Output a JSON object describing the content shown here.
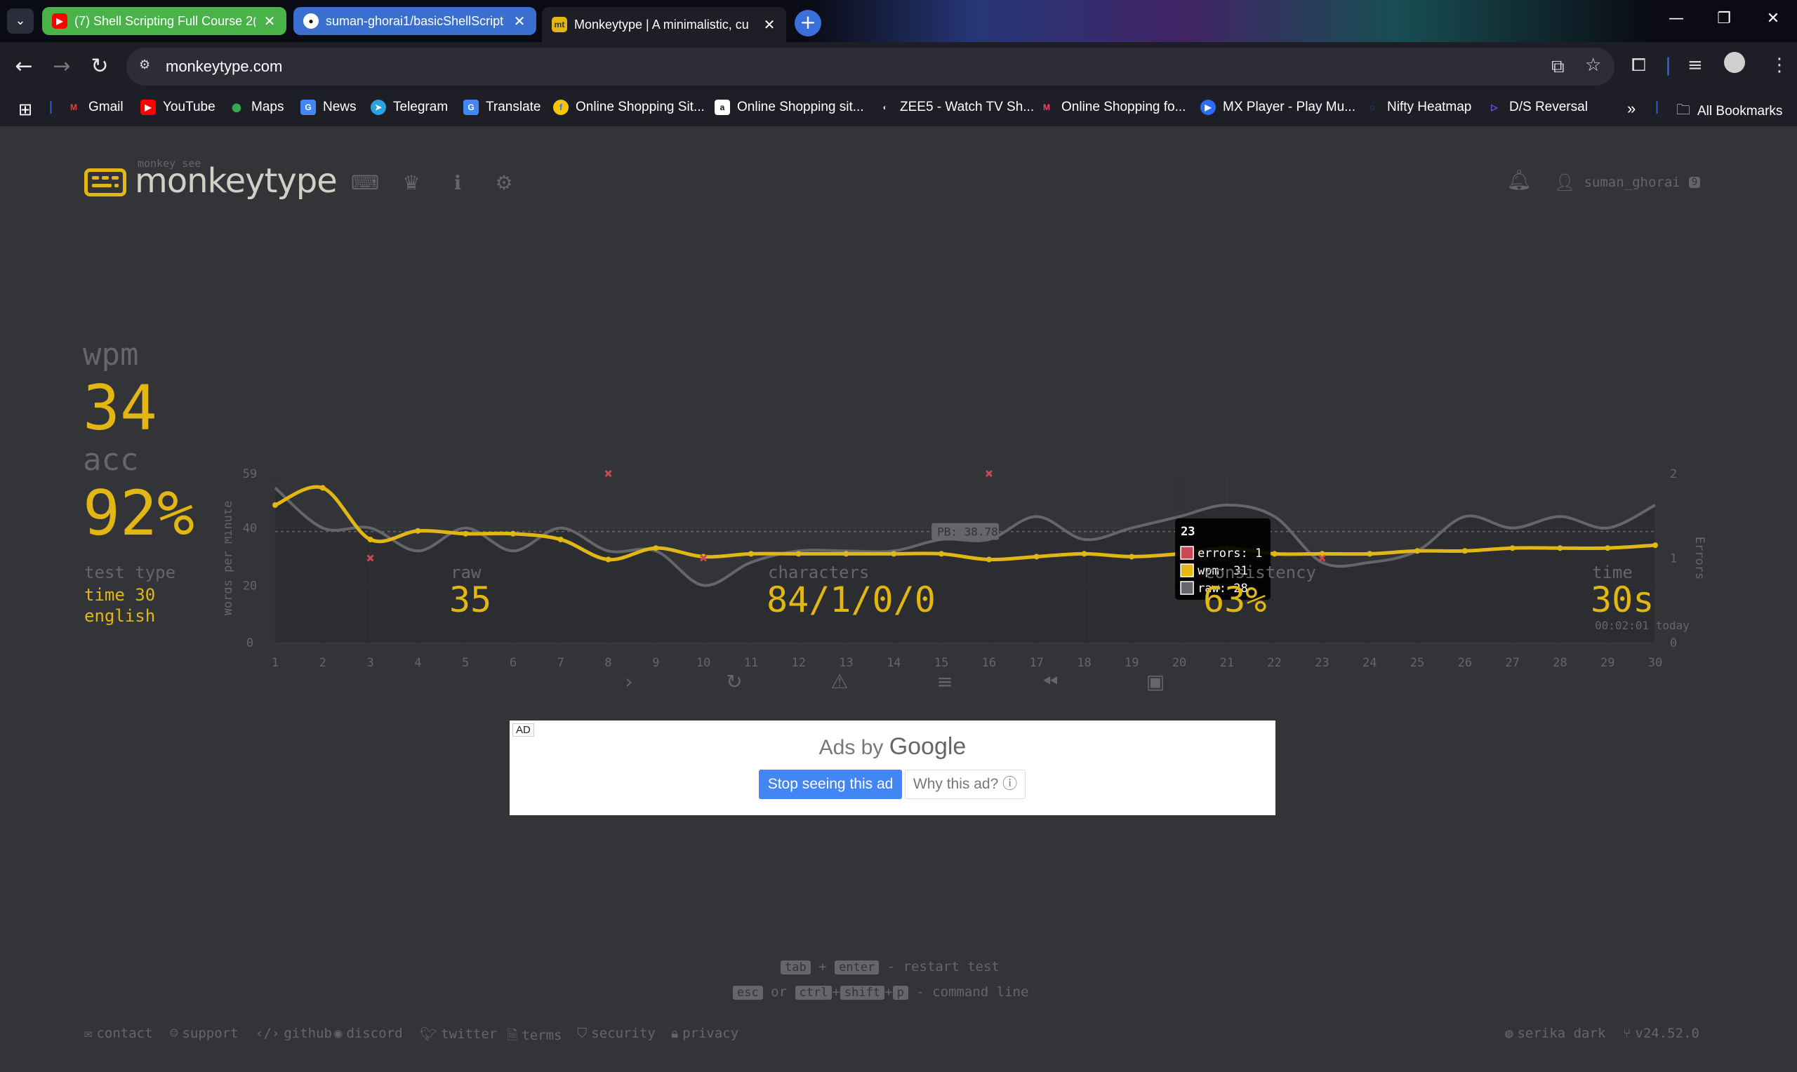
{
  "browser": {
    "tabs": [
      {
        "title": "(7) Shell Scripting Full Course 2(",
        "icon": "youtube-icon"
      },
      {
        "title": "suman-ghorai1/basicShellScript",
        "icon": "github-icon"
      },
      {
        "title": "Monkeytype | A minimalistic, cu",
        "icon": "monkeytype-icon"
      }
    ],
    "url": "monkeytype.com",
    "bookmarks": [
      "Gmail",
      "YouTube",
      "Maps",
      "News",
      "Telegram",
      "Translate",
      "Online Shopping Sit...",
      "Online Shopping sit...",
      "ZEE5 - Watch TV Sh...",
      "Online Shopping fo...",
      "MX Player - Play Mu...",
      "Nifty Heatmap",
      "D/S Reversal"
    ],
    "all_bookmarks": "All Bookmarks"
  },
  "header": {
    "logo_small": "monkey see",
    "logo_text": "monkeytype",
    "username": "suman_ghorai",
    "level": "9"
  },
  "result": {
    "wpm_label": "wpm",
    "wpm": "34",
    "acc_label": "acc",
    "acc": "92%",
    "test_type_label": "test type",
    "test_type_mode": "time 30",
    "test_type_lang": "english",
    "raw_label": "raw",
    "raw": "35",
    "characters_label": "characters",
    "characters": "84/1/0/0",
    "consistency_label": "consistency",
    "consistency": "63%",
    "time_label": "time",
    "time": "30s",
    "time_sub": "00:02:01 today"
  },
  "chart_data": {
    "type": "line",
    "ylabel": "Words per Minute",
    "y2label": "Errors",
    "ylim": [
      0,
      59
    ],
    "y2lim": [
      0,
      2
    ],
    "yticks": [
      0,
      20,
      40,
      59
    ],
    "y2ticks": [
      0,
      1,
      2
    ],
    "x": [
      1,
      2,
      3,
      4,
      5,
      6,
      7,
      8,
      9,
      10,
      11,
      12,
      13,
      14,
      15,
      16,
      17,
      18,
      19,
      20,
      21,
      22,
      23,
      24,
      25,
      26,
      27,
      28,
      29,
      30
    ],
    "series": [
      {
        "name": "wpm",
        "color": "#e2b714",
        "values": [
          48,
          54,
          36,
          39,
          38,
          38,
          36,
          29,
          33,
          30,
          31,
          31,
          31,
          31,
          31,
          29,
          30,
          31,
          30,
          31,
          33,
          31,
          31,
          31,
          32,
          32,
          33,
          33,
          33,
          34
        ]
      },
      {
        "name": "raw",
        "color": "#646669",
        "values": [
          54,
          40,
          40,
          32,
          40,
          32,
          40,
          32,
          32,
          20,
          28,
          32,
          32,
          32,
          36,
          36,
          44,
          36,
          40,
          44,
          48,
          44,
          28,
          28,
          32,
          44,
          40,
          44,
          40,
          48
        ]
      },
      {
        "name": "errors",
        "color": "#ca4754",
        "points": [
          [
            3,
            1
          ],
          [
            8,
            2
          ],
          [
            10,
            1
          ],
          [
            16,
            2
          ],
          [
            23,
            1
          ]
        ]
      }
    ],
    "pb_label": "PB: 38.78",
    "pb_value": 38.78,
    "tooltip": {
      "title": "23",
      "errors": "errors: 1",
      "wpm": "wpm: 31",
      "raw": "raw: 28"
    }
  },
  "shortcuts": {
    "tab": "tab",
    "plus": "+",
    "enter": "enter",
    "restart": "- restart test",
    "esc": "esc",
    "or": "or",
    "ctrl": "ctrl",
    "shift": "shift",
    "p": "p",
    "command": "- command line"
  },
  "ad": {
    "tag": "AD",
    "ads_by": "Ads by",
    "google": "Google",
    "stop": "Stop seeing this ad",
    "why": "Why this ad? ⓘ"
  },
  "footer": {
    "links": [
      "contact",
      "support",
      "github",
      "discord",
      "twitter",
      "terms",
      "security",
      "privacy"
    ],
    "theme": "serika dark",
    "version": "v24.52.0"
  }
}
